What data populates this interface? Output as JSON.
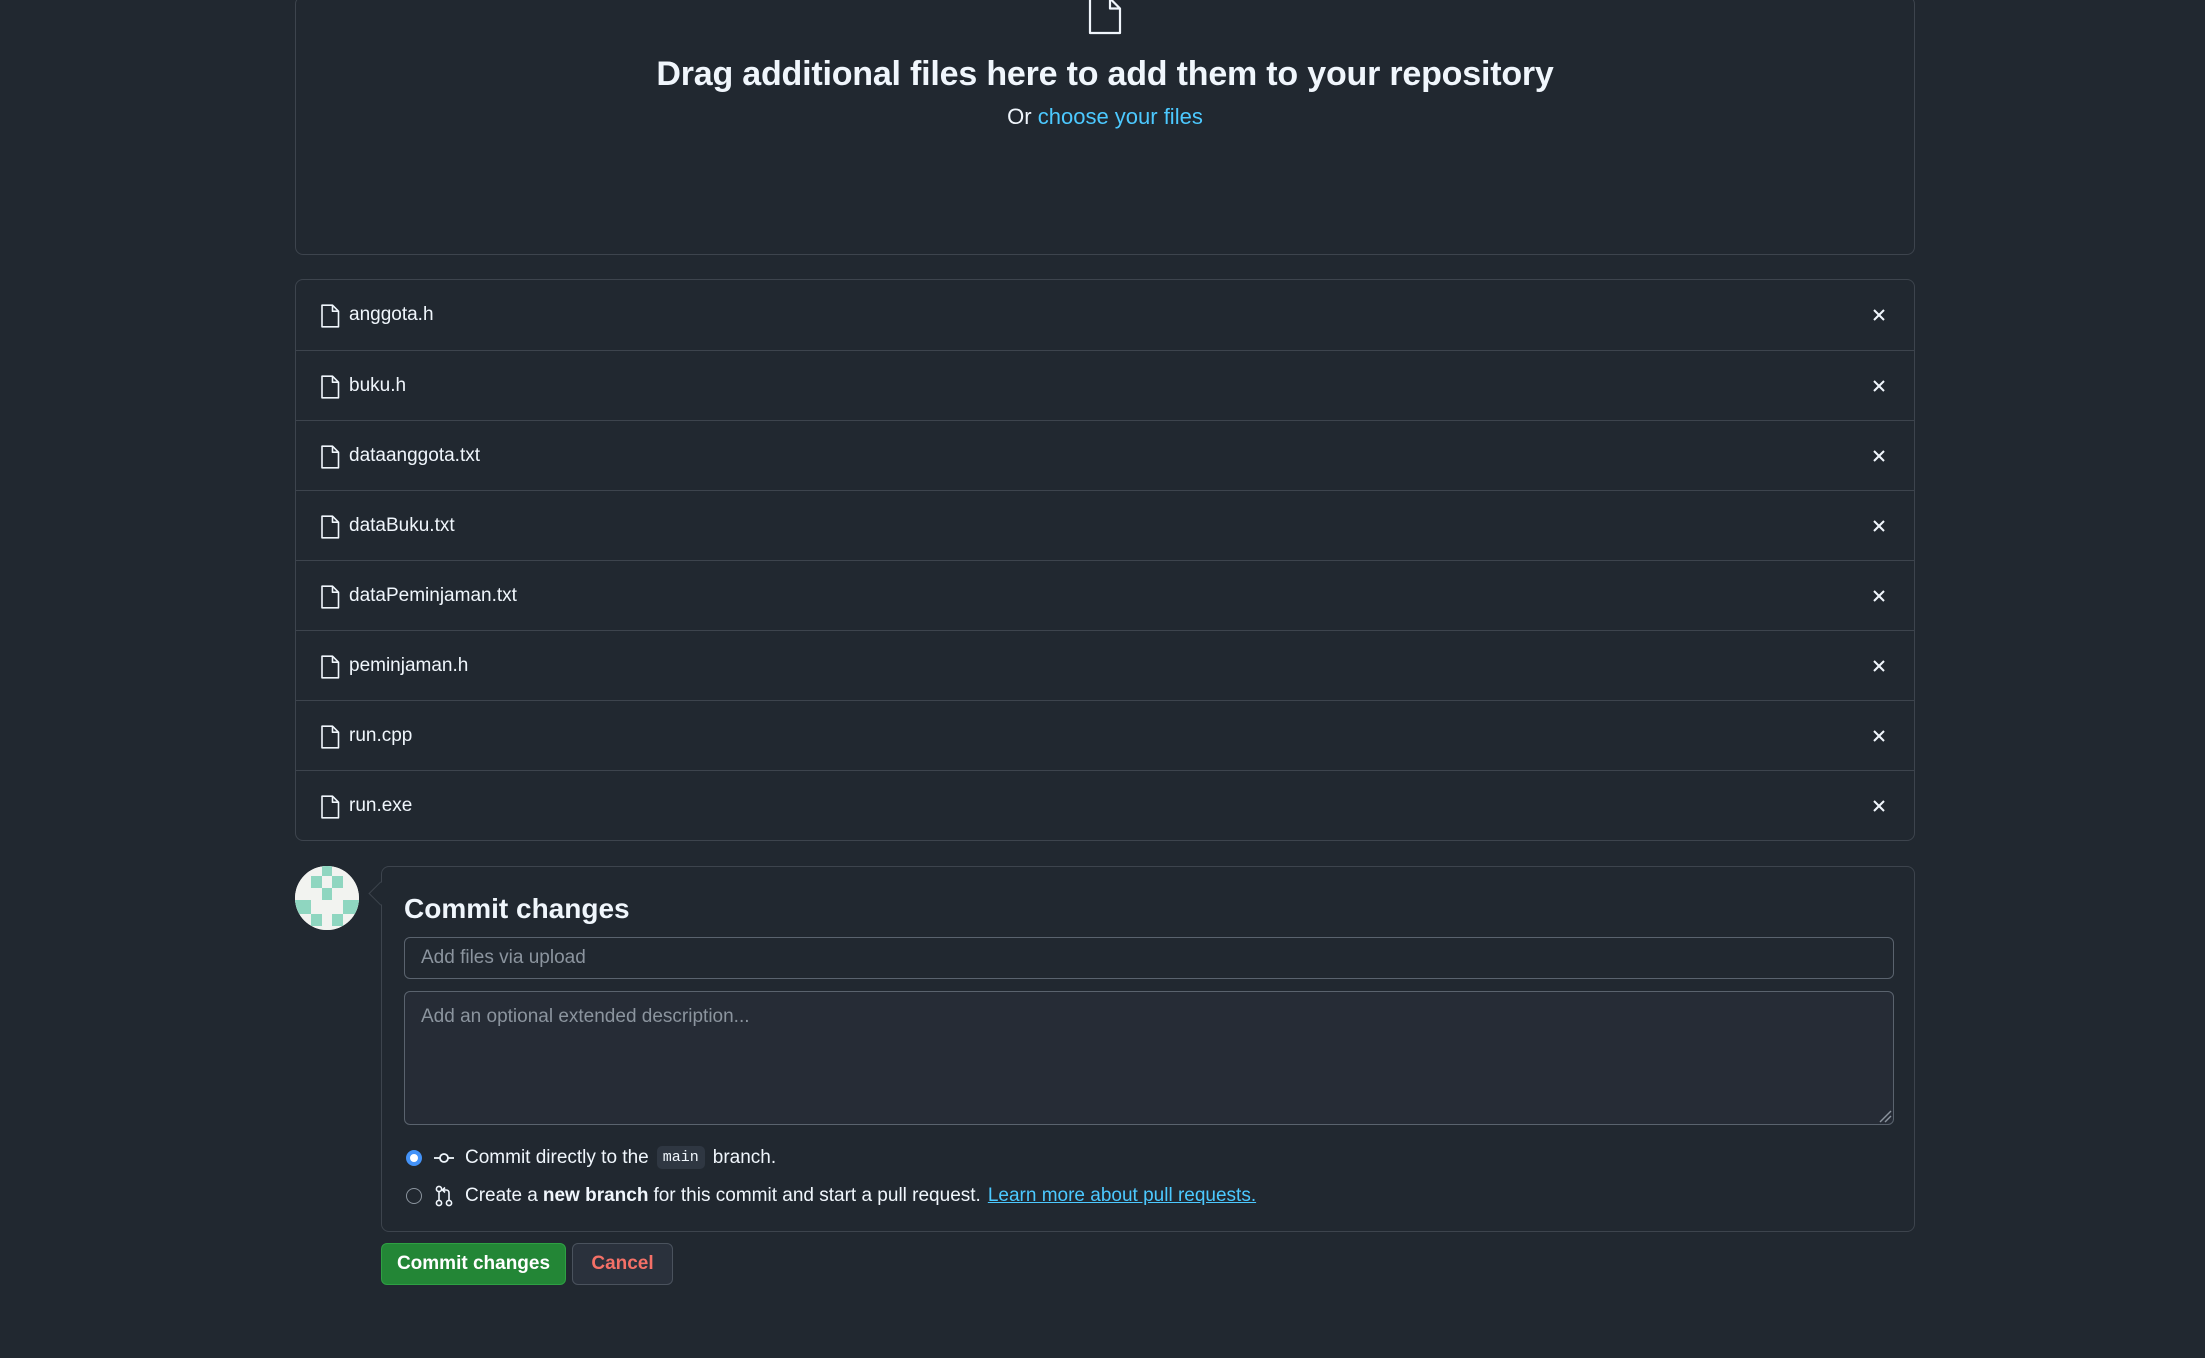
{
  "dropzone": {
    "icon": "file-icon",
    "title": "Drag additional files here to add them to your repository",
    "sub_prefix": "Or ",
    "sub_link": "choose your files"
  },
  "files": [
    {
      "name": "anggota.h",
      "icon": "file-icon",
      "remove_icon": "close-icon"
    },
    {
      "name": "buku.h",
      "icon": "file-icon",
      "remove_icon": "close-icon"
    },
    {
      "name": "dataanggota.txt",
      "icon": "file-icon",
      "remove_icon": "close-icon"
    },
    {
      "name": "dataBuku.txt",
      "icon": "file-icon",
      "remove_icon": "close-icon"
    },
    {
      "name": "dataPeminjaman.txt",
      "icon": "file-icon",
      "remove_icon": "close-icon"
    },
    {
      "name": "peminjaman.h",
      "icon": "file-icon",
      "remove_icon": "close-icon"
    },
    {
      "name": "run.cpp",
      "icon": "file-icon",
      "remove_icon": "close-icon"
    },
    {
      "name": "run.exe",
      "icon": "file-icon",
      "remove_icon": "close-icon"
    }
  ],
  "commit": {
    "title": "Commit changes",
    "summary_placeholder": "Add files via upload",
    "summary_value": "",
    "description_placeholder": "Add an optional extended description...",
    "description_value": "",
    "option_direct": {
      "checked": true,
      "icon": "git-commit-icon",
      "prefix": "Commit directly to the",
      "branch": "main",
      "suffix": "branch."
    },
    "option_branch": {
      "checked": false,
      "icon": "git-pull-request-icon",
      "prefix": "Create a",
      "strong": "new branch",
      "suffix": "for this commit and start a pull request.",
      "link": "Learn more about pull requests."
    }
  },
  "buttons": {
    "commit_label": "Commit changes",
    "cancel_label": "Cancel"
  },
  "colors": {
    "background": "#212830",
    "border": "#3d444d",
    "link": "#4cc9ff",
    "primary_button": "#238636",
    "danger_text": "#f47067",
    "radio_checked": "#4493f8"
  }
}
